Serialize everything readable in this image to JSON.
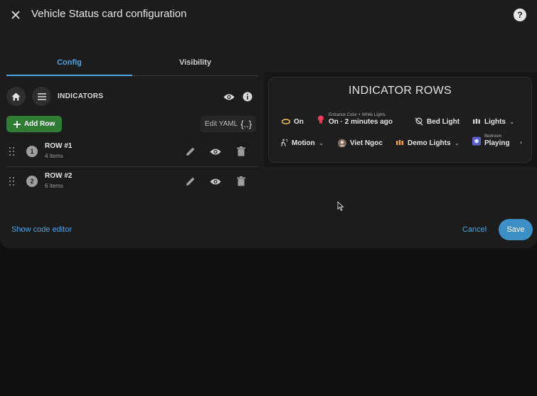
{
  "header": {
    "title": "Vehicle Status card configuration"
  },
  "tabs": [
    {
      "label": "Config"
    },
    {
      "label": "Visibility"
    }
  ],
  "toolbar": {
    "section_label": "INDICATORS"
  },
  "actions": {
    "add_row": "Add Row",
    "edit_yaml": "Edit YAML",
    "edit_yaml_brace": "{..}"
  },
  "rows": [
    {
      "number": "1",
      "title": "ROW #1",
      "subtitle": "4 items"
    },
    {
      "number": "2",
      "title": "ROW #2",
      "subtitle": "6 items"
    }
  ],
  "footer": {
    "show_code": "Show code editor",
    "cancel": "Cancel",
    "save": "Save"
  },
  "preview": {
    "title": "INDICATOR ROWS",
    "row1": [
      {
        "label": "On",
        "icon": "car-icon"
      },
      {
        "small": "Entrance Color + White Lights",
        "label": "On · 2 minutes ago",
        "icon": "bulb-icon"
      },
      {
        "label": "Bed Light",
        "icon": "lightbulb-off-icon"
      },
      {
        "label": "Lights",
        "icon": "lights-group-icon"
      }
    ],
    "row2": [
      {
        "label": "Motion",
        "icon": "motion-icon"
      },
      {
        "label": "Viet Ngoc",
        "icon": "person-avatar"
      },
      {
        "label": "Demo Lights",
        "icon": "lights-group-icon"
      },
      {
        "small": "Bedroom",
        "label": "Playing",
        "icon": "media-player-icon"
      }
    ]
  },
  "colors": {
    "accent": "#4aa3df",
    "add_row": "#2e7d32",
    "save": "#3b8fc4"
  }
}
